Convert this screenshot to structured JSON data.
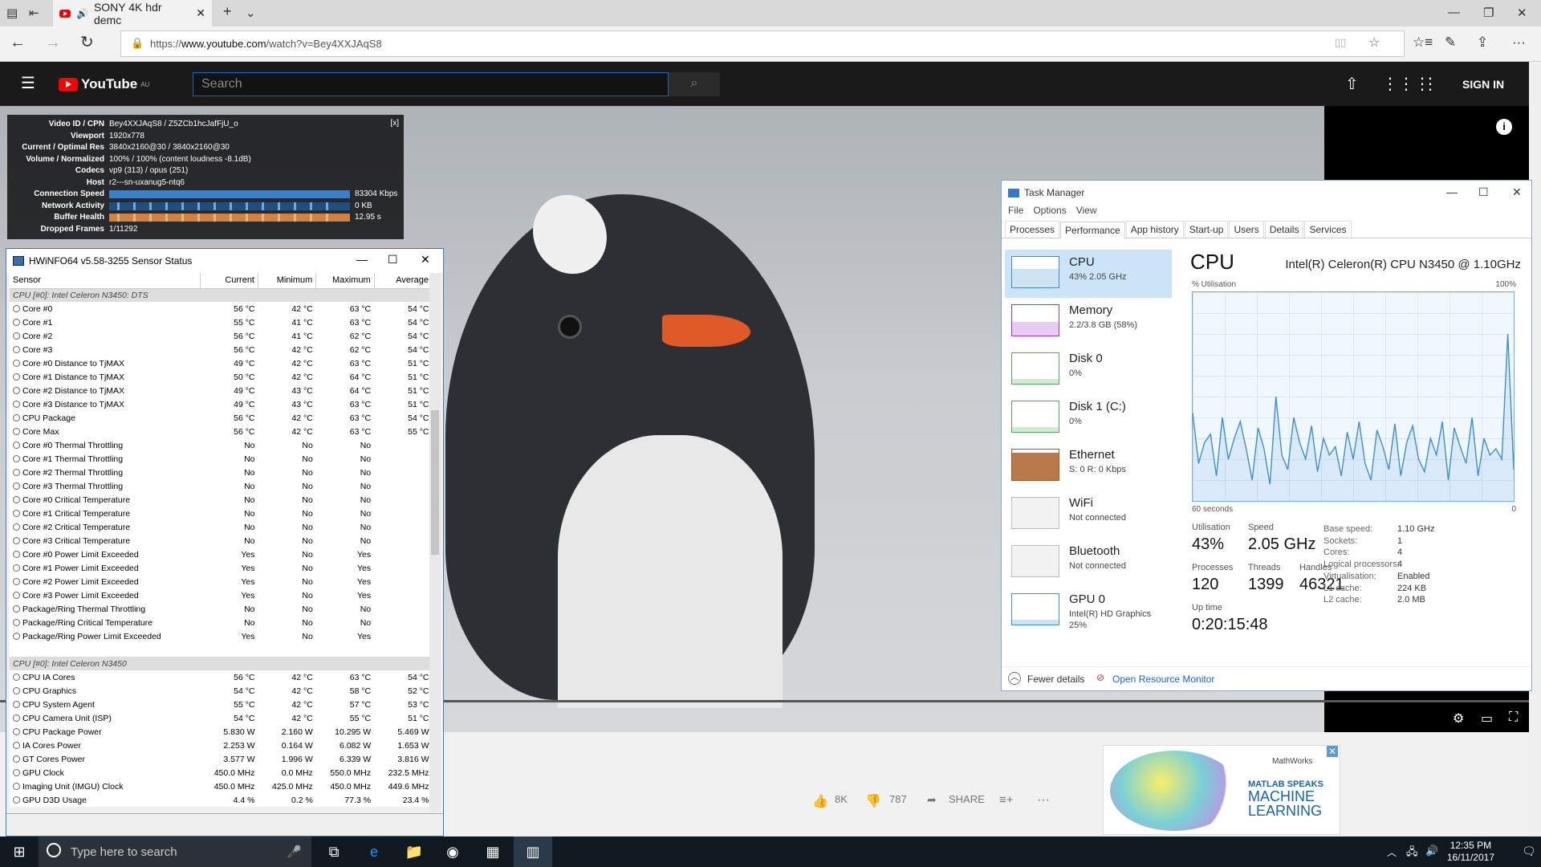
{
  "browser": {
    "tab_title": "SONY 4K hdr demc",
    "url_prefix": "https://",
    "url_domain": "www.youtube.com",
    "url_path": "/watch?v=Bey4XXJAqS8"
  },
  "youtube": {
    "logo": "YouTube",
    "region": "AU",
    "search_placeholder": "Search",
    "sign_in": "SIGN IN",
    "likes": "8K",
    "dislikes": "787",
    "share": "SHARE"
  },
  "stats": {
    "close": "[x]",
    "rows": [
      {
        "k": "Video ID / CPN",
        "v": "Bey4XXJAqS8 / Z5ZCb1hcJafFjU_o"
      },
      {
        "k": "Viewport",
        "v": "1920x778"
      },
      {
        "k": "Current / Optimal Res",
        "v": "3840x2160@30 / 3840x2160@30"
      },
      {
        "k": "Volume / Normalized",
        "v": "100% / 100% (content loudness -8.1dB)"
      },
      {
        "k": "Codecs",
        "v": "vp9 (313) / opus (251)"
      },
      {
        "k": "Host",
        "v": "r2---sn-uxanug5-ntq6"
      }
    ],
    "bars": [
      {
        "k": "Connection Speed",
        "v": "83304 Kbps"
      },
      {
        "k": "Network Activity",
        "v": "0 KB"
      },
      {
        "k": "Buffer Health",
        "v": "12.95 s"
      }
    ],
    "dropped_label": "Dropped Frames",
    "dropped": "1/11292"
  },
  "hwinfo": {
    "title": "HWiNFO64 v5.58-3255 Sensor Status",
    "columns": [
      "Sensor",
      "Current",
      "Minimum",
      "Maximum",
      "Average"
    ],
    "group1": "CPU [#0]: Intel Celeron N3450: DTS",
    "rows1": [
      [
        "Core #0",
        "56 °C",
        "42 °C",
        "63 °C",
        "54 °C"
      ],
      [
        "Core #1",
        "55 °C",
        "41 °C",
        "63 °C",
        "54 °C"
      ],
      [
        "Core #2",
        "56 °C",
        "41 °C",
        "62 °C",
        "54 °C"
      ],
      [
        "Core #3",
        "56 °C",
        "42 °C",
        "62 °C",
        "54 °C"
      ],
      [
        "Core #0 Distance to TjMAX",
        "49 °C",
        "42 °C",
        "63 °C",
        "51 °C"
      ],
      [
        "Core #1 Distance to TjMAX",
        "50 °C",
        "42 °C",
        "64 °C",
        "51 °C"
      ],
      [
        "Core #2 Distance to TjMAX",
        "49 °C",
        "43 °C",
        "64 °C",
        "51 °C"
      ],
      [
        "Core #3 Distance to TjMAX",
        "49 °C",
        "43 °C",
        "63 °C",
        "51 °C"
      ],
      [
        "CPU Package",
        "56 °C",
        "42 °C",
        "63 °C",
        "54 °C"
      ],
      [
        "Core Max",
        "56 °C",
        "42 °C",
        "63 °C",
        "55 °C"
      ],
      [
        "Core #0 Thermal Throttling",
        "No",
        "No",
        "No",
        ""
      ],
      [
        "Core #1 Thermal Throttling",
        "No",
        "No",
        "No",
        ""
      ],
      [
        "Core #2 Thermal Throttling",
        "No",
        "No",
        "No",
        ""
      ],
      [
        "Core #3 Thermal Throttling",
        "No",
        "No",
        "No",
        ""
      ],
      [
        "Core #0 Critical Temperature",
        "No",
        "No",
        "No",
        ""
      ],
      [
        "Core #1 Critical Temperature",
        "No",
        "No",
        "No",
        ""
      ],
      [
        "Core #2 Critical Temperature",
        "No",
        "No",
        "No",
        ""
      ],
      [
        "Core #3 Critical Temperature",
        "No",
        "No",
        "No",
        ""
      ],
      [
        "Core #0 Power Limit Exceeded",
        "Yes",
        "No",
        "Yes",
        ""
      ],
      [
        "Core #1 Power Limit Exceeded",
        "Yes",
        "No",
        "Yes",
        ""
      ],
      [
        "Core #2 Power Limit Exceeded",
        "Yes",
        "No",
        "Yes",
        ""
      ],
      [
        "Core #3 Power Limit Exceeded",
        "Yes",
        "No",
        "Yes",
        ""
      ],
      [
        "Package/Ring Thermal Throttling",
        "No",
        "No",
        "No",
        ""
      ],
      [
        "Package/Ring Critical Temperature",
        "No",
        "No",
        "No",
        ""
      ],
      [
        "Package/Ring Power Limit Exceeded",
        "Yes",
        "No",
        "Yes",
        ""
      ]
    ],
    "group2": "CPU [#0]: Intel Celeron N3450",
    "rows2": [
      [
        "CPU IA Cores",
        "56 °C",
        "42 °C",
        "63 °C",
        "54 °C"
      ],
      [
        "CPU Graphics",
        "54 °C",
        "42 °C",
        "58 °C",
        "52 °C"
      ],
      [
        "CPU System Agent",
        "55 °C",
        "42 °C",
        "57 °C",
        "53 °C"
      ],
      [
        "CPU Camera Unit (ISP)",
        "54 °C",
        "42 °C",
        "55 °C",
        "51 °C"
      ],
      [
        "CPU Package Power",
        "5.830 W",
        "2.160 W",
        "10.295 W",
        "5.469 W"
      ],
      [
        "IA Cores Power",
        "2.253 W",
        "0.164 W",
        "6.082 W",
        "1.653 W"
      ],
      [
        "GT Cores Power",
        "3.577 W",
        "1.996 W",
        "6.339 W",
        "3.816 W"
      ],
      [
        "GPU Clock",
        "450.0 MHz",
        "0.0 MHz",
        "550.0 MHz",
        "232.5 MHz"
      ],
      [
        "Imaging Unit (IMGU) Clock",
        "450.0 MHz",
        "425.0 MHz",
        "450.0 MHz",
        "449.6 MHz"
      ],
      [
        "GPU D3D Usage",
        "4.4 %",
        "0.2 %",
        "77.3 %",
        "23.4 %"
      ]
    ]
  },
  "taskmgr": {
    "title": "Task Manager",
    "menu": [
      "File",
      "Options",
      "View"
    ],
    "tabs": [
      "Processes",
      "Performance",
      "App history",
      "Start-up",
      "Users",
      "Details",
      "Services"
    ],
    "side": [
      {
        "name": "CPU",
        "sub": "43% 2.05 GHz",
        "color": "#3c8fd3"
      },
      {
        "name": "Memory",
        "sub": "2.2/3.8 GB (58%)",
        "color": "#9b38c8"
      },
      {
        "name": "Disk 0",
        "sub": "0%",
        "color": "#4caf50"
      },
      {
        "name": "Disk 1 (C:)",
        "sub": "0%",
        "color": "#4caf50"
      },
      {
        "name": "Ethernet",
        "sub": "S: 0 R: 0 Kbps",
        "color": "#a7581d"
      },
      {
        "name": "WiFi",
        "sub": "Not connected",
        "color": "#bbbbbb"
      },
      {
        "name": "Bluetooth",
        "sub": "Not connected",
        "color": "#bbbbbb"
      },
      {
        "name": "GPU 0",
        "sub": "Intel(R) HD Graphics",
        "sub2": "25%",
        "color": "#3c8fd3"
      }
    ],
    "cpu_title": "CPU",
    "cpu_model": "Intel(R) Celeron(R) CPU N3450 @ 1.10GHz",
    "util_label": "% Utilisation",
    "util_max": "100%",
    "time_label": "60 seconds",
    "time_min": "0",
    "utilisation_label": "Utilisation",
    "utilisation": "43%",
    "speed_label": "Speed",
    "speed": "2.05 GHz",
    "processes_label": "Processes",
    "processes": "120",
    "threads_label": "Threads",
    "threads": "1399",
    "handles_label": "Handles",
    "handles": "46321",
    "uptime_label": "Up time",
    "uptime": "0:20:15:48",
    "specs": [
      {
        "k": "Base speed:",
        "v": "1.10 GHz"
      },
      {
        "k": "Sockets:",
        "v": "1"
      },
      {
        "k": "Cores:",
        "v": "4"
      },
      {
        "k": "Logical processors:",
        "v": "4"
      },
      {
        "k": "Virtualisation:",
        "v": "Enabled"
      },
      {
        "k": "L1 cache:",
        "v": "224 KB"
      },
      {
        "k": "L2 cache:",
        "v": "2.0 MB"
      }
    ],
    "fewer": "Fewer details",
    "resmon": "Open Resource Monitor",
    "cpu_graph": [
      42,
      18,
      28,
      32,
      12,
      40,
      20,
      30,
      38,
      25,
      10,
      35,
      25,
      8,
      50,
      22,
      15,
      40,
      28,
      20,
      36,
      14,
      30,
      22,
      26,
      12,
      33,
      20,
      38,
      18,
      10,
      34,
      26,
      15,
      37,
      12,
      28,
      36,
      20,
      14,
      30,
      22,
      38,
      10,
      35,
      26,
      18,
      40,
      12,
      30,
      22,
      25,
      20,
      80,
      15
    ]
  },
  "taskbar": {
    "search": "Type here to search",
    "time": "12:35 PM",
    "date": "16/11/2017"
  },
  "ad": {
    "brand": "MathWorks",
    "line1": "MATLAB SPEAKS",
    "line2": "MACHINE",
    "line3": "LEARNING"
  }
}
